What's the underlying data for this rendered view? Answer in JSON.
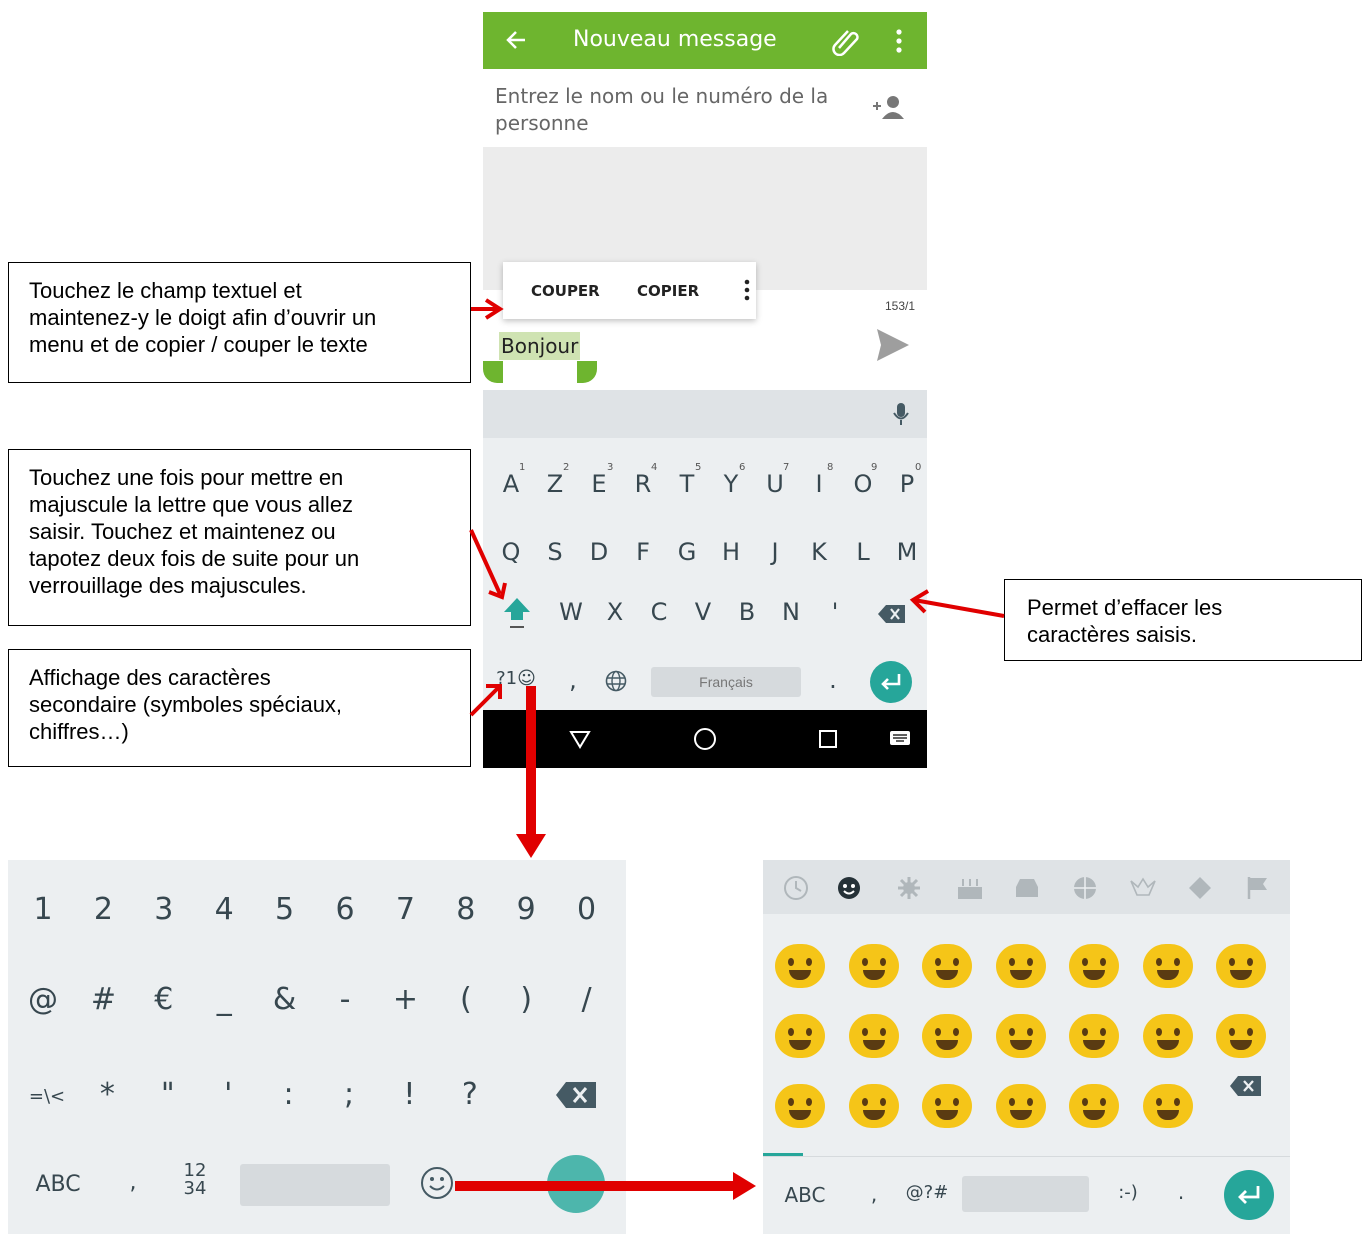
{
  "callouts": {
    "copy_cut": "Touchez le champ textuel et\nmaintenez-y le doigt afin d’ouvrir un\nmenu et de copier / couper le texte",
    "shift": "Touchez une fois pour mettre en\nmajuscule la lettre que vous allez\nsaisir. Touchez et maintenez ou\ntapotez deux fois de suite pour un\nverrouillage des majuscules.",
    "symbols": "Affichage des caractères\nsecondaire (symboles spéciaux,\nchiffres…)",
    "delete": "Permet d’effacer les\ncaractères saisis."
  },
  "phone": {
    "title": "Nouveau message",
    "recipient_placeholder": "Entrez le nom ou le numéro de la personne",
    "context_menu": {
      "cut": "COUPER",
      "copy": "COPIER"
    },
    "counter": "153/1",
    "selected_text": "Bonjour",
    "accent_color": "#6eb52f",
    "keyboard": {
      "row1": [
        "A",
        "Z",
        "E",
        "R",
        "T",
        "Y",
        "U",
        "I",
        "O",
        "P"
      ],
      "row1_hints": [
        "1",
        "2",
        "3",
        "4",
        "5",
        "6",
        "7",
        "8",
        "9",
        "0"
      ],
      "row2": [
        "Q",
        "S",
        "D",
        "F",
        "G",
        "H",
        "J",
        "K",
        "L",
        "M"
      ],
      "row3": [
        "W",
        "X",
        "C",
        "V",
        "B",
        "N",
        "'"
      ],
      "symbols_key": "?1☺",
      "comma": ",",
      "period": ".",
      "space_label": "Français"
    }
  },
  "numeric_keyboard": {
    "row1": [
      "1",
      "2",
      "3",
      "4",
      "5",
      "6",
      "7",
      "8",
      "9",
      "0"
    ],
    "row2": [
      "@",
      "#",
      "€",
      "_",
      "&",
      "-",
      "+",
      "(",
      ")",
      "/"
    ],
    "row3": [
      "=\\<",
      "*",
      "\"",
      "'",
      ":",
      ";",
      "!",
      "?"
    ],
    "abc": "ABC",
    "comma": ",",
    "numpad_top": "12",
    "numpad_bottom": "34",
    "period": "."
  },
  "emoji_keyboard": {
    "abc": "ABC",
    "comma": ",",
    "symbols": "@?#",
    "smiley": ":-)",
    "period": "."
  }
}
